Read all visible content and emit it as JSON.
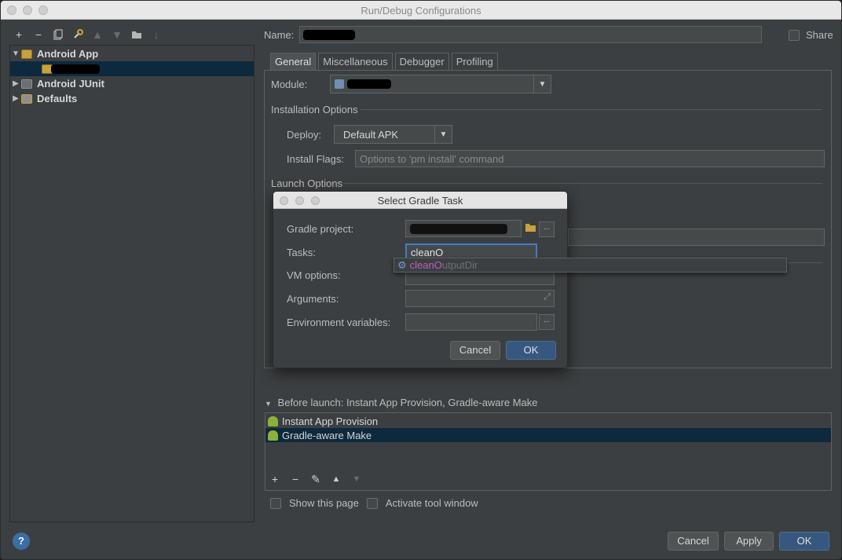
{
  "window": {
    "title": "Run/Debug Configurations"
  },
  "left_toolbar": {
    "buttons": [
      "+",
      "−",
      "copy",
      "wrench",
      "up",
      "down",
      "folder",
      "sort"
    ]
  },
  "tree": {
    "items": [
      {
        "label": "Android App",
        "expanded": true,
        "selected": false
      },
      {
        "label": "",
        "redacted": true,
        "selected": true
      },
      {
        "label": "Android JUnit",
        "expanded": false
      },
      {
        "label": "Defaults",
        "expanded": false
      }
    ]
  },
  "header": {
    "name_label": "Name:",
    "share_label": "Share"
  },
  "tabs": [
    {
      "label": "General",
      "active": true
    },
    {
      "label": "Miscellaneous",
      "active": false
    },
    {
      "label": "Debugger",
      "active": false
    },
    {
      "label": "Profiling",
      "active": false
    }
  ],
  "general": {
    "module_label": "Module:",
    "installation_options_label": "Installation Options",
    "deploy_label": "Deploy:",
    "deploy_value": "Default APK",
    "install_flags_label": "Install Flags:",
    "install_flags_placeholder": "Options to 'pm install' command",
    "launch_options_label": "Launch Options"
  },
  "before_launch": {
    "header": "Before launch: Instant App Provision, Gradle-aware Make",
    "items": [
      {
        "label": "Instant App Provision",
        "selected": false
      },
      {
        "label": "Gradle-aware Make",
        "selected": true
      }
    ],
    "toolbar": [
      "+",
      "−",
      "edit",
      "up",
      "down"
    ],
    "show_page_label": "Show this page",
    "activate_tool_window_label": "Activate tool window"
  },
  "footer": {
    "help_label": "?",
    "cancel_label": "Cancel",
    "apply_label": "Apply",
    "ok_label": "OK"
  },
  "dialog": {
    "title": "Select Gradle Task",
    "gradle_project_label": "Gradle project:",
    "tasks_label": "Tasks:",
    "tasks_value": "cleanO",
    "vm_options_label": "VM options:",
    "arguments_label": "Arguments:",
    "env_vars_label": "Environment variables:",
    "browse_label": "...",
    "cancel_label": "Cancel",
    "ok_label": "OK"
  },
  "autocomplete": {
    "match": "cleanO",
    "rest": "utputDir"
  },
  "colors": {
    "background": "#3c3f41",
    "selection": "#0d293e",
    "primary_button": "#365880",
    "match_highlight": "#c25abf"
  }
}
